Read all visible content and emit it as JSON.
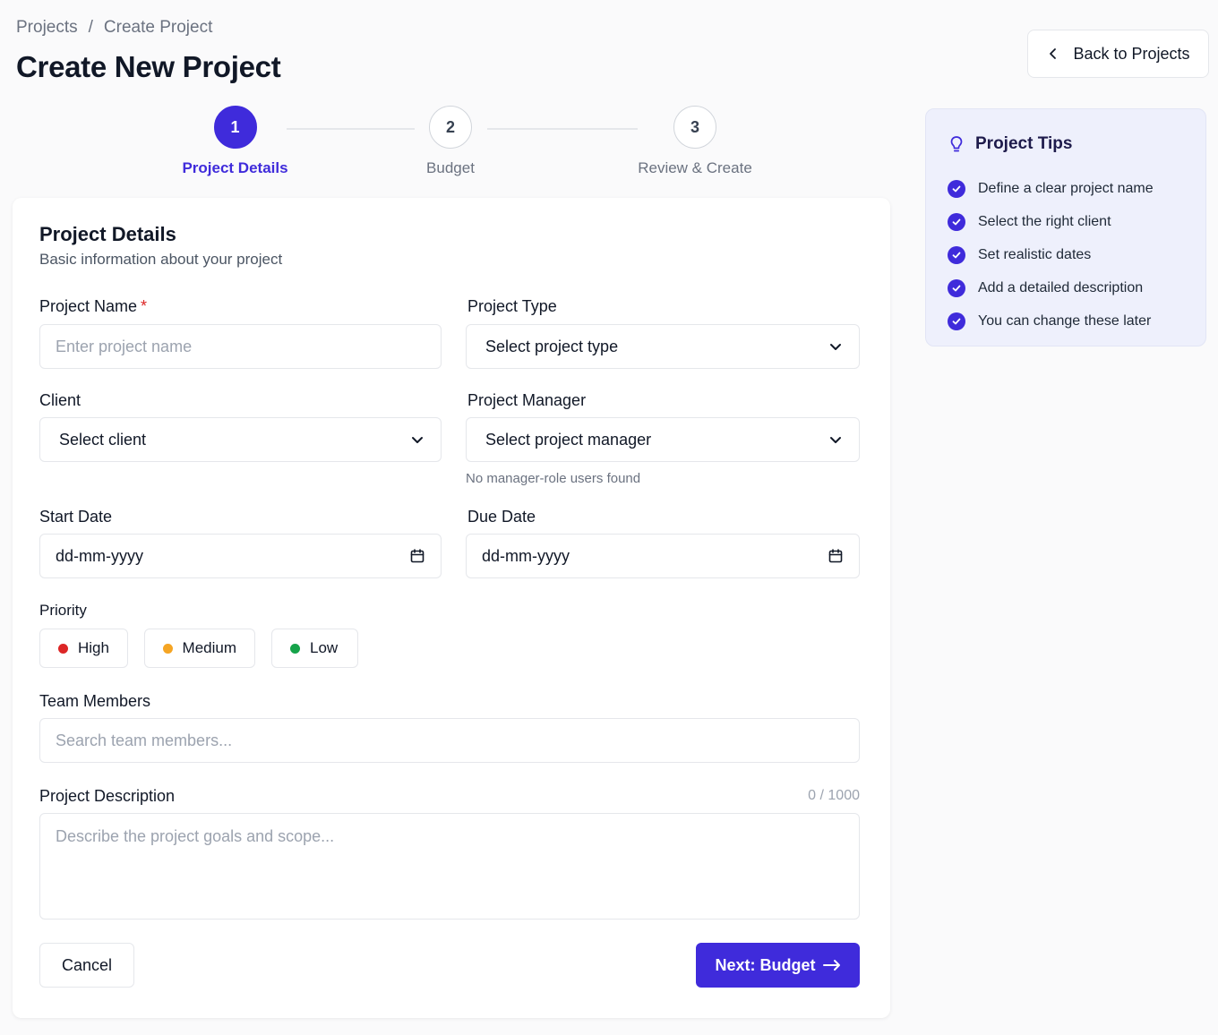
{
  "breadcrumb": {
    "parent": "Projects",
    "separator": "/",
    "current": "Create Project"
  },
  "page_title": "Create New Project",
  "back_button": {
    "label": "Back to Projects",
    "icon": "chevron-left-icon"
  },
  "steps": [
    {
      "number": "1",
      "label": "Project Details",
      "active": true
    },
    {
      "number": "2",
      "label": "Budget",
      "active": false
    },
    {
      "number": "3",
      "label": "Review & Create",
      "active": false
    }
  ],
  "form": {
    "title": "Project Details",
    "subtitle": "Basic information about your project",
    "project_name": {
      "label": "Project Name",
      "required_mark": "*",
      "placeholder": "Enter project name"
    },
    "project_type": {
      "label": "Project Type",
      "value": "Select project type"
    },
    "client": {
      "label": "Client",
      "value": "Select client"
    },
    "project_manager": {
      "label": "Project Manager",
      "value": "Select project manager",
      "hint": "No manager-role users found"
    },
    "start_date": {
      "label": "Start Date",
      "value": "dd-mm-yyyy"
    },
    "due_date": {
      "label": "Due Date",
      "value": "dd-mm-yyyy"
    },
    "priority": {
      "label": "Priority",
      "options": [
        {
          "label": "High",
          "color": "#dc2626"
        },
        {
          "label": "Medium",
          "color": "#f5a524"
        },
        {
          "label": "Low",
          "color": "#16a34a"
        }
      ]
    },
    "team_members": {
      "label": "Team Members",
      "placeholder": "Search team members..."
    },
    "description": {
      "label": "Project Description",
      "counter": "0 / 1000",
      "placeholder": "Describe the project goals and scope..."
    },
    "cancel_label": "Cancel",
    "next_label": "Next: Budget"
  },
  "tips": {
    "title": "Project Tips",
    "items": [
      "Define a clear project name",
      "Select the right client",
      "Set realistic dates",
      "Add a detailed description",
      "You can change these later"
    ]
  },
  "colors": {
    "accent": "#3f2bdb",
    "tips_bg": "#eef0fc"
  }
}
